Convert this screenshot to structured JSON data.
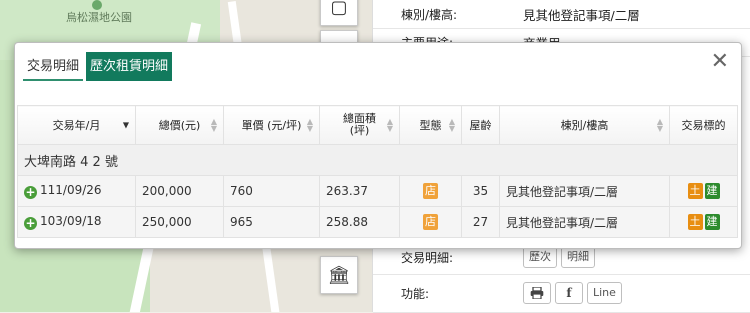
{
  "map": {
    "place_label": "烏松濕地公園"
  },
  "map_buttons": [
    {
      "icon": "layers-icon",
      "glyph": "▢"
    },
    {
      "icon": "ruler-icon",
      "glyph": "✎"
    },
    {
      "icon": "landmark-icon",
      "glyph": "🏛"
    }
  ],
  "info_panel": {
    "rows": [
      {
        "label": "棟別/樓高:",
        "value": "見其他登記事項/二層"
      },
      {
        "label": "主要用途:",
        "value": "商業用"
      }
    ],
    "detail_row": {
      "label": "交易明細:",
      "buttons": [
        "歷次",
        "明細"
      ]
    },
    "function_row": {
      "label": "功能:",
      "icons": [
        "print-icon",
        "facebook-icon"
      ],
      "line_label": "Line"
    }
  },
  "modal": {
    "tabs": [
      "交易明細",
      "歷次租賃明細"
    ],
    "active_tab": 1,
    "close_glyph": "✕",
    "table": {
      "headers": [
        "交易年/月",
        "總價(元)",
        "單價 (元/坪)",
        "總面積\n(坪)",
        "型態",
        "屋齡",
        "棟別/樓高",
        "交易標的"
      ],
      "group_label": "大埤南路 4 2 號",
      "rows": [
        {
          "date": "111/09/26",
          "total": "200,000",
          "unit": "760",
          "area": "263.37",
          "type": "店",
          "age": "35",
          "floor": "見其他登記事項/二層",
          "target": [
            "土",
            "建"
          ]
        },
        {
          "date": "103/09/18",
          "total": "250,000",
          "unit": "965",
          "area": "258.88",
          "type": "店",
          "age": "27",
          "floor": "見其他登記事項/二層",
          "target": [
            "土",
            "建"
          ]
        }
      ]
    }
  }
}
